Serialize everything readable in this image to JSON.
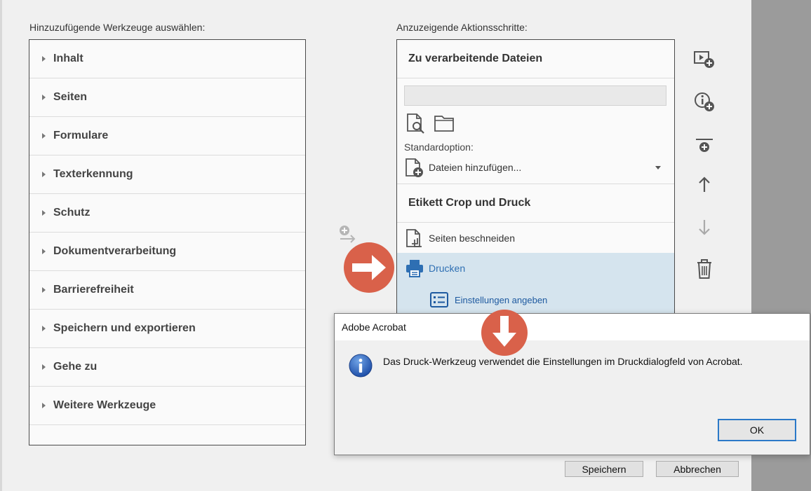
{
  "tools_heading": "Hinzuzufügende Werkzeuge auswählen:",
  "actions_heading": "Anzuzeigende Aktionsschritte:",
  "tools": [
    "Inhalt",
    "Seiten",
    "Formulare",
    "Texterkennung",
    "Schutz",
    "Dokumentverarbeitung",
    "Barrierefreiheit",
    "Speichern und exportieren",
    "Gehe zu",
    "Weitere Werkzeuge"
  ],
  "actions": {
    "section1_title": "Zu verarbeitende Dateien",
    "files_box_value": "",
    "standard_option_label": "Standardoption:",
    "standard_option_value": "Dateien hinzufügen...",
    "section2_title": "Etikett Crop und Druck",
    "step1": "Seiten beschneiden",
    "step2": "Drucken",
    "step2_sub": "Einstellungen angeben"
  },
  "dialog": {
    "title": "Adobe Acrobat",
    "message": "Das Druck-Werkzeug verwendet die Einstellungen im Druckdialogfeld von Acrobat.",
    "ok_label": "OK"
  },
  "footer": {
    "save_label": "Speichern",
    "cancel_label": "Abbrechen"
  },
  "colors": {
    "selected_row": "#d5e4ee",
    "link_blue": "#2e6fb3",
    "callout_orange": "#d9614a",
    "focus_blue": "#2b79c8"
  }
}
